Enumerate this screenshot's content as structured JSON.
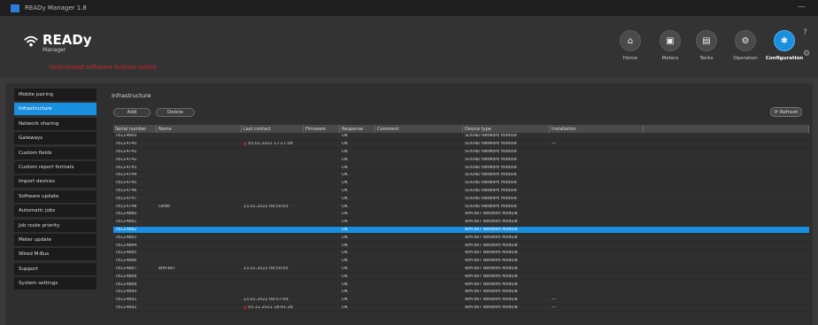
{
  "window": {
    "title": "READy Manager 1.8"
  },
  "app": {
    "title": "READy",
    "subtitle": "Manager",
    "license_notice": "Unlicensed software license notice"
  },
  "nav": [
    {
      "label": "Home",
      "icon": "home-icon"
    },
    {
      "label": "Meters",
      "icon": "meter-icon"
    },
    {
      "label": "Tanks",
      "icon": "tank-icon"
    },
    {
      "label": "Operation",
      "icon": "operation-icon"
    },
    {
      "label": "Configuration",
      "icon": "gear-icon",
      "active": true
    }
  ],
  "sidebar": {
    "items": [
      {
        "label": "Mobile pairing"
      },
      {
        "label": "Infrastructure",
        "active": true
      },
      {
        "label": "Network sharing"
      },
      {
        "label": "Gateways"
      },
      {
        "label": "Custom fields"
      },
      {
        "label": "Custom report formats"
      },
      {
        "label": "Import devices"
      },
      {
        "label": "Software update"
      },
      {
        "label": "Automatic jobs"
      },
      {
        "label": "Job route priority"
      },
      {
        "label": "Meter update"
      },
      {
        "label": "Wired M-Bus"
      },
      {
        "label": "Support"
      },
      {
        "label": "System settings"
      }
    ]
  },
  "main": {
    "title": "Infrastructure",
    "buttons": {
      "add": "Add",
      "delete": "Delete",
      "refresh": "Refresh"
    },
    "columns": [
      "Serial number",
      "Name",
      "Last contact",
      "Firmware",
      "Response",
      "Comment",
      "Device type",
      "Installation",
      ""
    ],
    "rows": [
      {
        "serial": "78114660",
        "name": "",
        "last": "",
        "fw": "",
        "resp": "OK",
        "type": "SOUND Network module",
        "inst": "",
        "warn": false
      },
      {
        "serial": "78114740",
        "name": "",
        "last": "03.01.2022 17:17:08",
        "fw": "",
        "resp": "OK",
        "type": "SOUND Network module",
        "inst": "—",
        "warn": true
      },
      {
        "serial": "78114741",
        "name": "",
        "last": "",
        "fw": "",
        "resp": "OK",
        "type": "SOUND Network module",
        "inst": "",
        "warn": false
      },
      {
        "serial": "78114742",
        "name": "",
        "last": "",
        "fw": "",
        "resp": "OK",
        "type": "SOUND Network module",
        "inst": "",
        "warn": false
      },
      {
        "serial": "78114743",
        "name": "",
        "last": "",
        "fw": "",
        "resp": "OK",
        "type": "SOUND Network module",
        "inst": "",
        "warn": false
      },
      {
        "serial": "78114744",
        "name": "",
        "last": "",
        "fw": "",
        "resp": "OK",
        "type": "SOUND Network module",
        "inst": "",
        "warn": false
      },
      {
        "serial": "78114745",
        "name": "",
        "last": "",
        "fw": "",
        "resp": "OK",
        "type": "SOUND Network module",
        "inst": "",
        "warn": false
      },
      {
        "serial": "78114746",
        "name": "",
        "last": "",
        "fw": "",
        "resp": "OK",
        "type": "SOUND Network module",
        "inst": "",
        "warn": false
      },
      {
        "serial": "78114747",
        "name": "",
        "last": "",
        "fw": "",
        "resp": "OK",
        "type": "SOUND Network module",
        "inst": "",
        "warn": false
      },
      {
        "serial": "78114748",
        "name": "Octet",
        "last": "13.01.2022 09:50:03",
        "fw": "",
        "resp": "OK",
        "type": "SOUND Network module",
        "inst": "",
        "warn": false
      },
      {
        "serial": "78114880",
        "name": "",
        "last": "",
        "fw": "",
        "resp": "OK",
        "type": "WM-bs7 Network Module",
        "inst": "",
        "warn": false
      },
      {
        "serial": "78114881",
        "name": "",
        "last": "",
        "fw": "",
        "resp": "OK",
        "type": "WM-bs7 Network Module",
        "inst": "",
        "warn": false
      },
      {
        "serial": "78114882",
        "name": "",
        "last": "",
        "fw": "",
        "resp": "OK",
        "type": "WM-bs7 Network Module",
        "inst": "",
        "warn": false,
        "selected": true
      },
      {
        "serial": "78114883",
        "name": "",
        "last": "",
        "fw": "",
        "resp": "OK",
        "type": "WM-bs7 Network Module",
        "inst": "",
        "warn": false
      },
      {
        "serial": "78114884",
        "name": "",
        "last": "",
        "fw": "",
        "resp": "OK",
        "type": "WM-bs7 Network Module",
        "inst": "",
        "warn": false
      },
      {
        "serial": "78114885",
        "name": "",
        "last": "",
        "fw": "",
        "resp": "OK",
        "type": "WM-bs7 Network Module",
        "inst": "",
        "warn": false
      },
      {
        "serial": "78114886",
        "name": "",
        "last": "",
        "fw": "",
        "resp": "OK",
        "type": "WM-bs7 Network Module",
        "inst": "",
        "warn": false
      },
      {
        "serial": "78114887",
        "name": "WM-bs7",
        "last": "13.01.2022 09:50:05",
        "fw": "",
        "resp": "OK",
        "type": "WM-bs7 Network Module",
        "inst": "",
        "warn": false
      },
      {
        "serial": "78114888",
        "name": "",
        "last": "",
        "fw": "",
        "resp": "OK",
        "type": "WM-bs7 Network Module",
        "inst": "",
        "warn": false
      },
      {
        "serial": "78114889",
        "name": "",
        "last": "",
        "fw": "",
        "resp": "OK",
        "type": "WM-bs7 Network Module",
        "inst": "",
        "warn": false
      },
      {
        "serial": "78114890",
        "name": "",
        "last": "",
        "fw": "",
        "resp": "OK",
        "type": "WM-bs7 Network Module",
        "inst": "",
        "warn": false
      },
      {
        "serial": "78114891",
        "name": "",
        "last": "13.01.2022 09:57:09",
        "fw": "",
        "resp": "OK",
        "type": "WM-bs7 Network Module",
        "inst": "—",
        "warn": false
      },
      {
        "serial": "78114892",
        "name": "",
        "last": "03.11.2021 18:41:28",
        "fw": "",
        "resp": "OK",
        "type": "WM-bs7 Network Module",
        "inst": "—",
        "warn": true
      }
    ]
  }
}
